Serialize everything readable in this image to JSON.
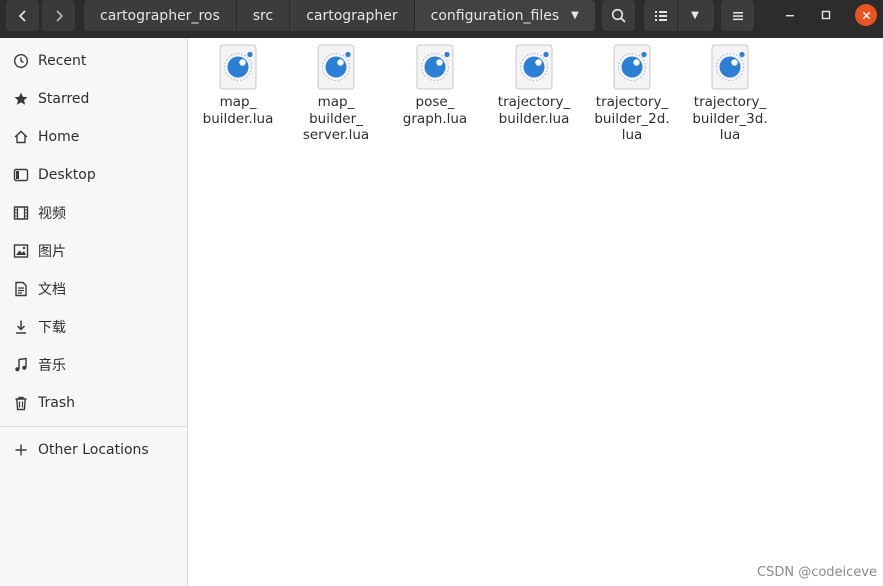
{
  "header": {
    "breadcrumbs": [
      {
        "label": "cartographer_ros"
      },
      {
        "label": "src"
      },
      {
        "label": "cartographer"
      },
      {
        "label": "configuration_files"
      }
    ]
  },
  "sidebar": {
    "items": [
      {
        "label": "Recent",
        "icon": "clock-icon"
      },
      {
        "label": "Starred",
        "icon": "star-icon"
      },
      {
        "label": "Home",
        "icon": "home-icon"
      },
      {
        "label": "Desktop",
        "icon": "desktop-icon"
      },
      {
        "label": "视频",
        "icon": "video-icon"
      },
      {
        "label": "图片",
        "icon": "image-icon"
      },
      {
        "label": "文档",
        "icon": "document-icon"
      },
      {
        "label": "下载",
        "icon": "download-icon"
      },
      {
        "label": "音乐",
        "icon": "music-icon"
      },
      {
        "label": "Trash",
        "icon": "trash-icon"
      }
    ],
    "other_locations": "Other Locations"
  },
  "files": [
    {
      "name": "map_\nbuilder.lua"
    },
    {
      "name": "map_\nbuilder_\nserver.lua"
    },
    {
      "name": "pose_\ngraph.lua"
    },
    {
      "name": "trajectory_\nbuilder.lua"
    },
    {
      "name": "trajectory_\nbuilder_2d.\nlua"
    },
    {
      "name": "trajectory_\nbuilder_3d.\nlua"
    }
  ],
  "watermark": "CSDN @codeiceve",
  "colors": {
    "header_bg": "#2c2c2c",
    "accent_close": "#e95420",
    "lua_icon_blue": "#2b7fd4"
  }
}
